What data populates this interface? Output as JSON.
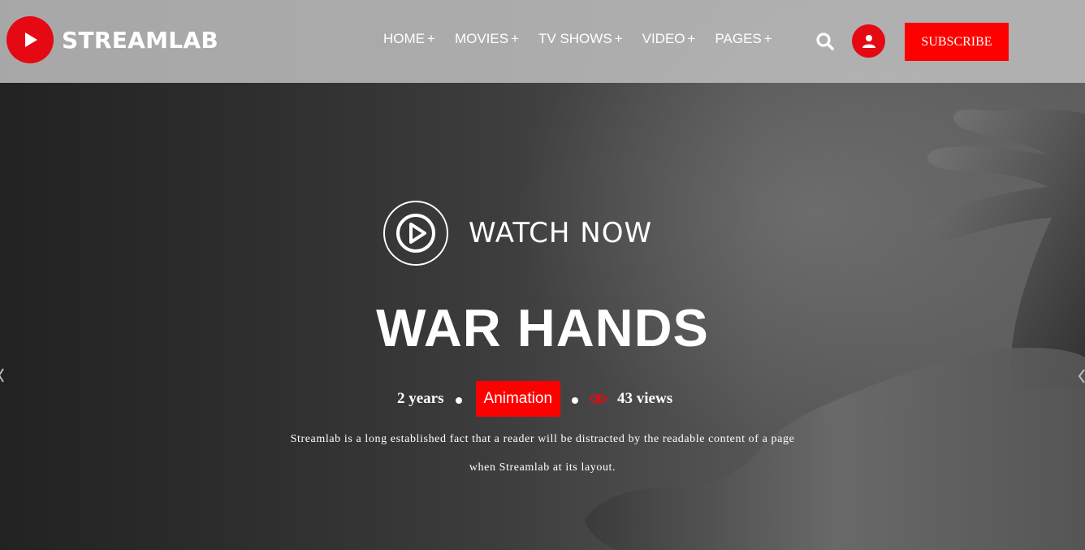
{
  "brand": {
    "name": "STREAMLAB",
    "accent": "#e50914",
    "cta_color": "#ff0000"
  },
  "nav": {
    "items": [
      {
        "label": "HOME",
        "plus": "+"
      },
      {
        "label": "MOVIES",
        "plus": "+"
      },
      {
        "label": "TV SHOWS",
        "plus": "+"
      },
      {
        "label": "VIDEO",
        "plus": "+"
      },
      {
        "label": "PAGES",
        "plus": "+"
      }
    ]
  },
  "header": {
    "search_icon": "search-icon",
    "user_icon": "user-icon",
    "subscribe_label": "SUBSCRIBE"
  },
  "hero": {
    "watch_label": "WATCH NOW",
    "title": "WAR HANDS",
    "age": "2 years",
    "genre": "Animation",
    "views": "43 views",
    "description_line1": "Streamlab is a long established fact that a reader will be distracted by the readable content of a page",
    "description_line2": "when Streamlab at its layout."
  }
}
